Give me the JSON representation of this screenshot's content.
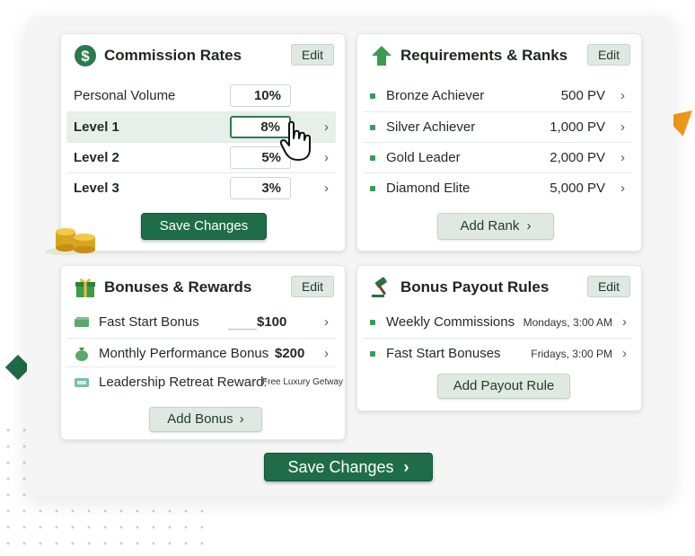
{
  "colors": {
    "primary": "#1f6d48",
    "accent_orange": "#f19a1c",
    "bullet": "#3a9a5e"
  },
  "commission": {
    "title": "Commission Rates",
    "icon": "dollar-icon",
    "edit": "Edit",
    "rows": [
      {
        "label": "Personal Volume",
        "value": "10%"
      },
      {
        "label": "Level 1",
        "value": "8%"
      },
      {
        "label": "Level 2",
        "value": "5%"
      },
      {
        "label": "Level 3",
        "value": "3%"
      }
    ],
    "save": "Save Changes"
  },
  "ranks": {
    "title": "Requirements & Ranks",
    "icon": "up-arrow-icon",
    "edit": "Edit",
    "items": [
      {
        "label": "Bronze Achiever",
        "pv": "500 PV"
      },
      {
        "label": "Silver Achiever",
        "pv": "1,000 PV"
      },
      {
        "label": "Gold Leader",
        "pv": "2,000 PV"
      },
      {
        "label": "Diamond Elite",
        "pv": "5,000 PV"
      }
    ],
    "add": "Add Rank"
  },
  "bonuses": {
    "title": "Bonuses & Rewards",
    "icon": "gift-icon",
    "edit": "Edit",
    "items": [
      {
        "label": "Fast Start Bonus",
        "value": "$100",
        "icon": "cash-icon"
      },
      {
        "label": "Monthly Performance Bonus",
        "value": "$200",
        "icon": "money-bag-icon"
      },
      {
        "label": "Leadership Retreat Reward:",
        "value": "Free Luxury Getway",
        "icon": "ticket-icon"
      }
    ],
    "add": "Add Bonus"
  },
  "payout": {
    "title": "Bonus Payout Rules",
    "icon": "gavel-icon",
    "edit": "Edit",
    "items": [
      {
        "label": "Weekly Commissions",
        "time": "Mondays, 3:00 AM"
      },
      {
        "label": "Fast Start Bonuses",
        "time": "Fridays, 3:00 PM"
      }
    ],
    "add": "Add Payout Rule"
  },
  "footer": {
    "save": "Save Changes"
  }
}
